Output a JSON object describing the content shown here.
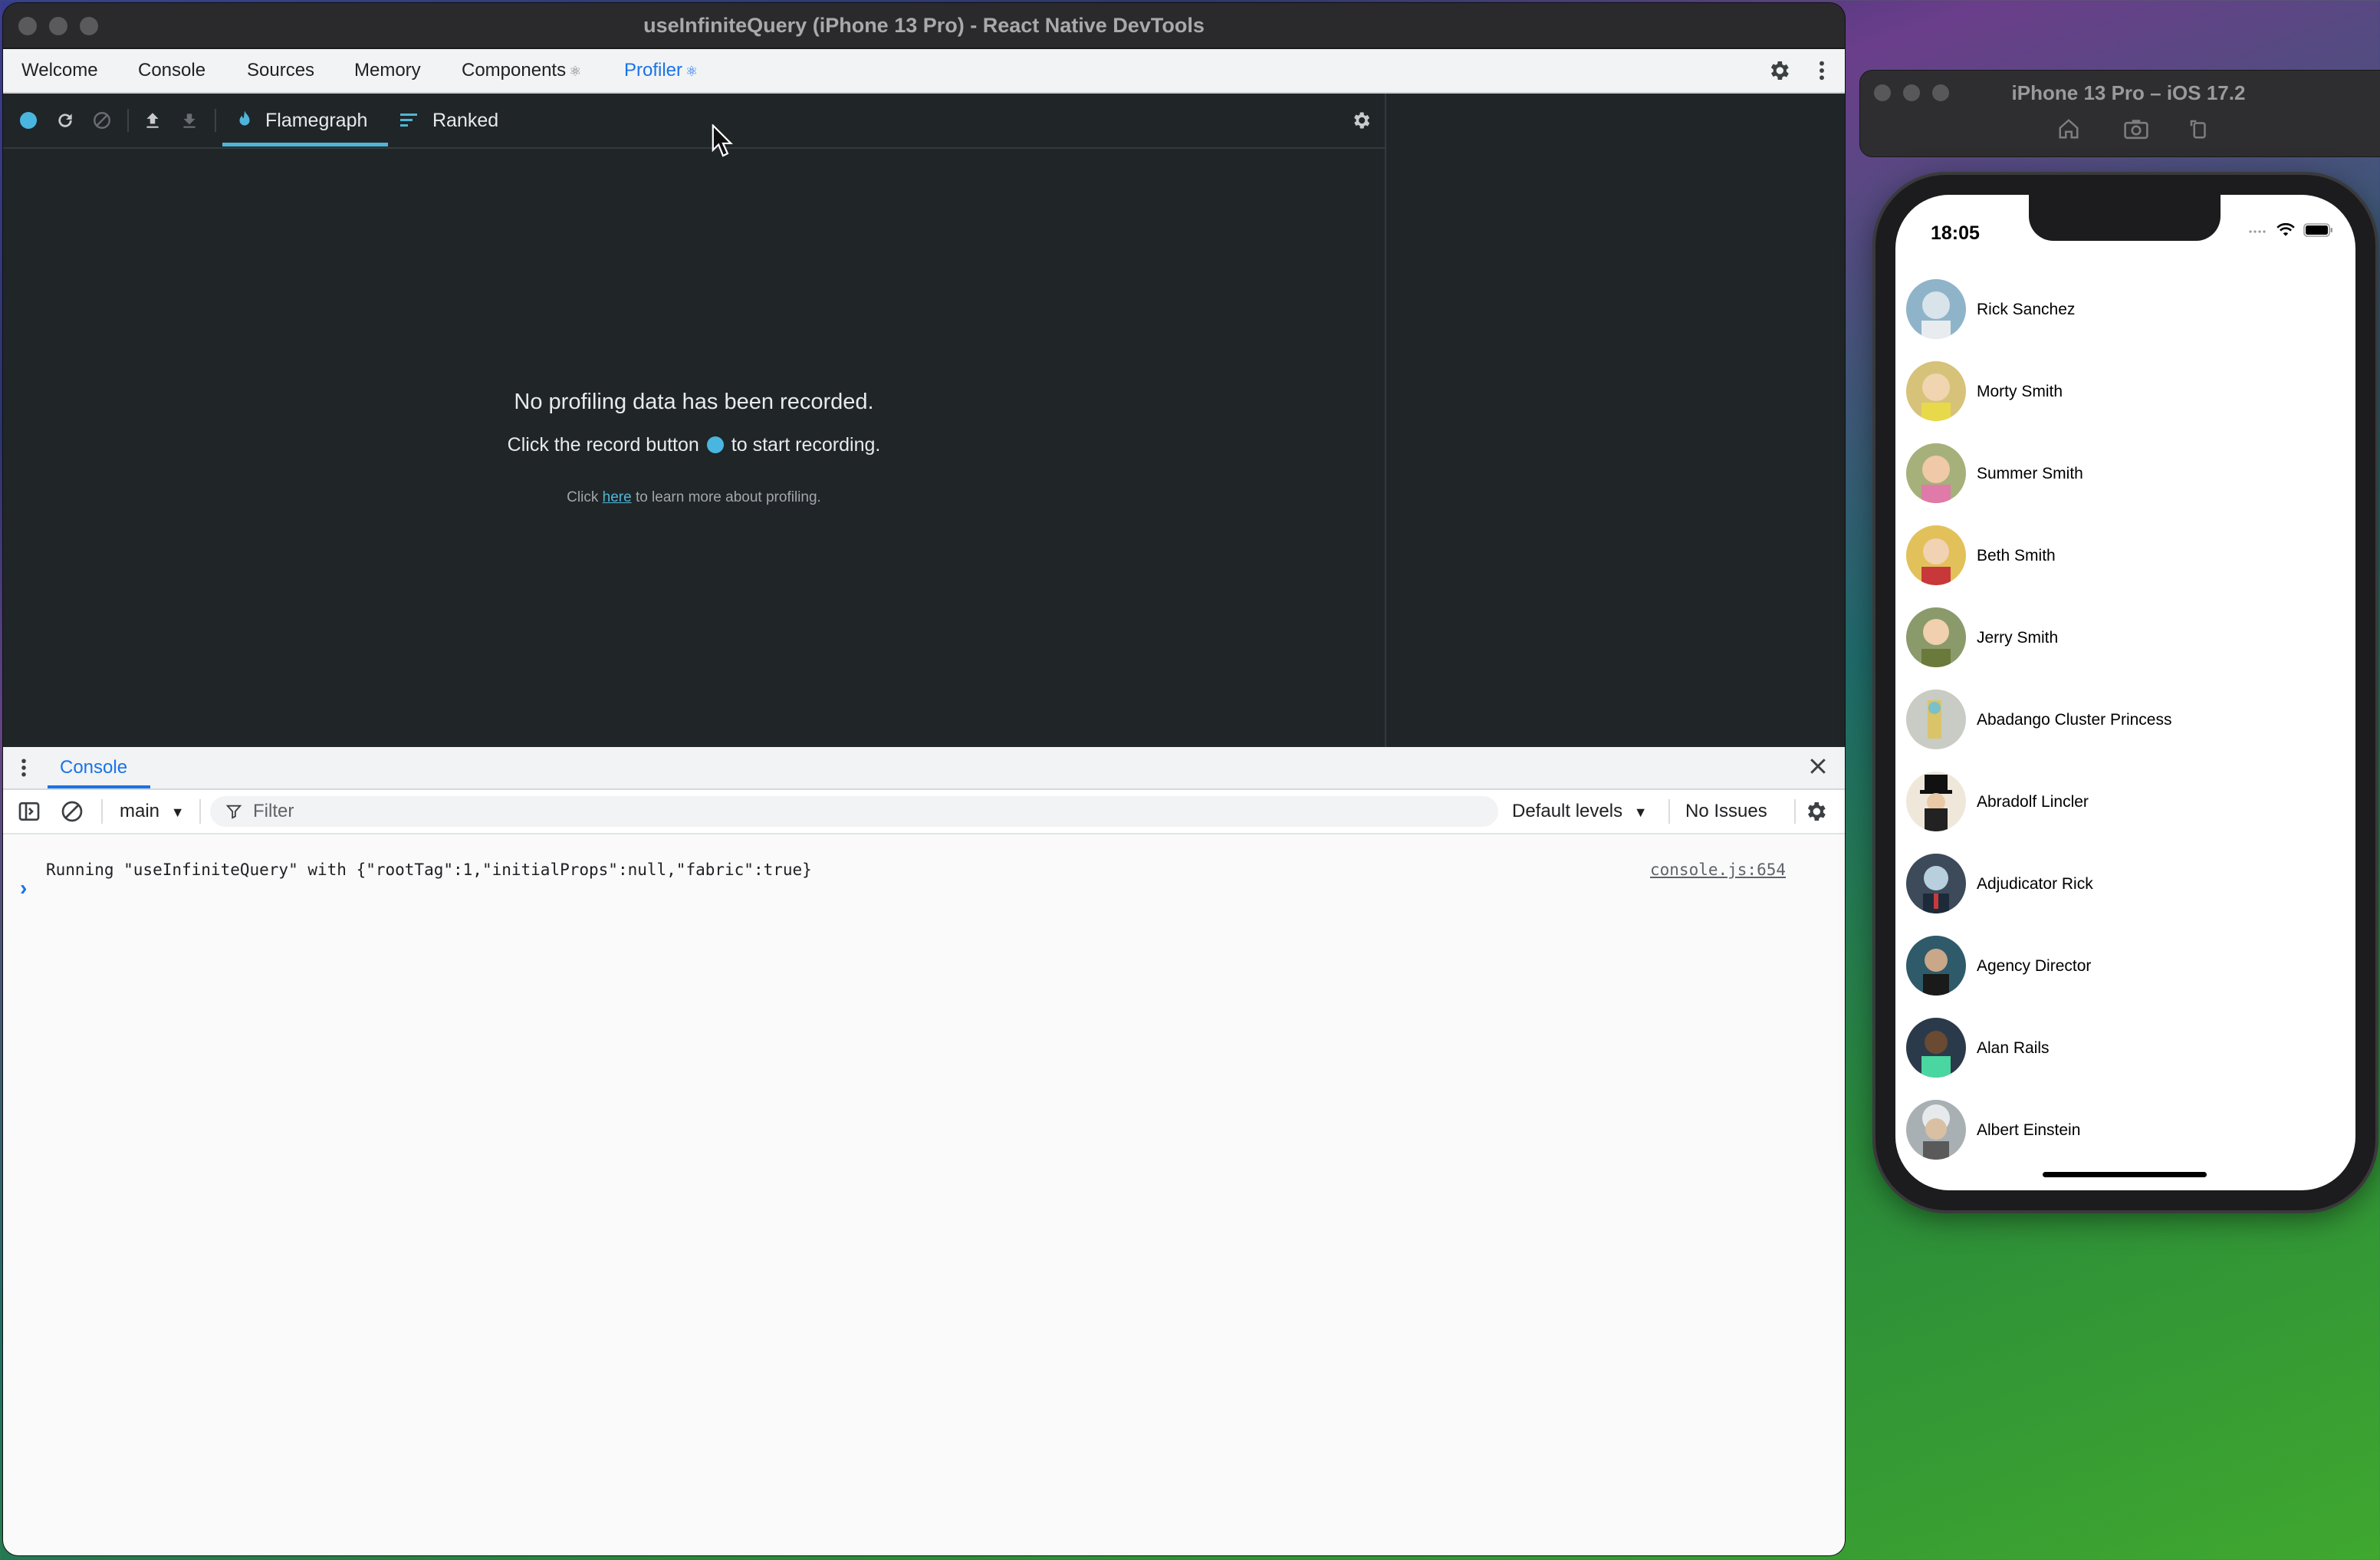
{
  "devtools": {
    "window_title": "useInfiniteQuery (iPhone 13 Pro) - React Native DevTools",
    "tabs": [
      {
        "label": "Welcome"
      },
      {
        "label": "Console"
      },
      {
        "label": "Sources"
      },
      {
        "label": "Memory"
      },
      {
        "label": "Components",
        "badge": "⚛"
      },
      {
        "label": "Profiler",
        "badge": "⚛",
        "active": true
      }
    ],
    "profiler": {
      "tabs": [
        "Flamegraph",
        "Ranked"
      ],
      "active_tab": "Flamegraph",
      "empty_title": "No profiling data has been recorded.",
      "empty_sub_before": "Click the record button",
      "empty_sub_after": "to start recording.",
      "learn_before": "Click",
      "learn_link": "here",
      "learn_after": "to learn more about profiling.",
      "record_color": "#49b6e0"
    },
    "drawer": {
      "tab": "Console",
      "context": "main",
      "filter_placeholder": "Filter",
      "levels": "Default levels",
      "issues": "No Issues",
      "log_message": "Running \"useInfiniteQuery\" with {\"rootTag\":1,\"initialProps\":null,\"fabric\":true}",
      "log_source": "console.js:654",
      "prompt": "›"
    }
  },
  "simulator": {
    "title": "iPhone 13 Pro – iOS 17.2",
    "status_time": "18:05",
    "characters": [
      {
        "name": "Rick Sanchez",
        "color": "#8fb4c9"
      },
      {
        "name": "Morty Smith",
        "color": "#d7c27a"
      },
      {
        "name": "Summer Smith",
        "color": "#a6b07a"
      },
      {
        "name": "Beth Smith",
        "color": "#e2c15a"
      },
      {
        "name": "Jerry Smith",
        "color": "#8a9a6a"
      },
      {
        "name": "Abadango Cluster Princess",
        "color": "#b9c0b0"
      },
      {
        "name": "Abradolf Lincler",
        "color": "#c9b89a"
      },
      {
        "name": "Adjudicator Rick",
        "color": "#3c4a5a"
      },
      {
        "name": "Agency Director",
        "color": "#2f5a6a"
      },
      {
        "name": "Alan Rails",
        "color": "#2b3a4a"
      },
      {
        "name": "Albert Einstein",
        "color": "#a9b0b4"
      }
    ]
  },
  "colors": {
    "accent": "#1a73e8",
    "profiler_bg": "#202528",
    "react_blue": "#4fb5d8"
  }
}
